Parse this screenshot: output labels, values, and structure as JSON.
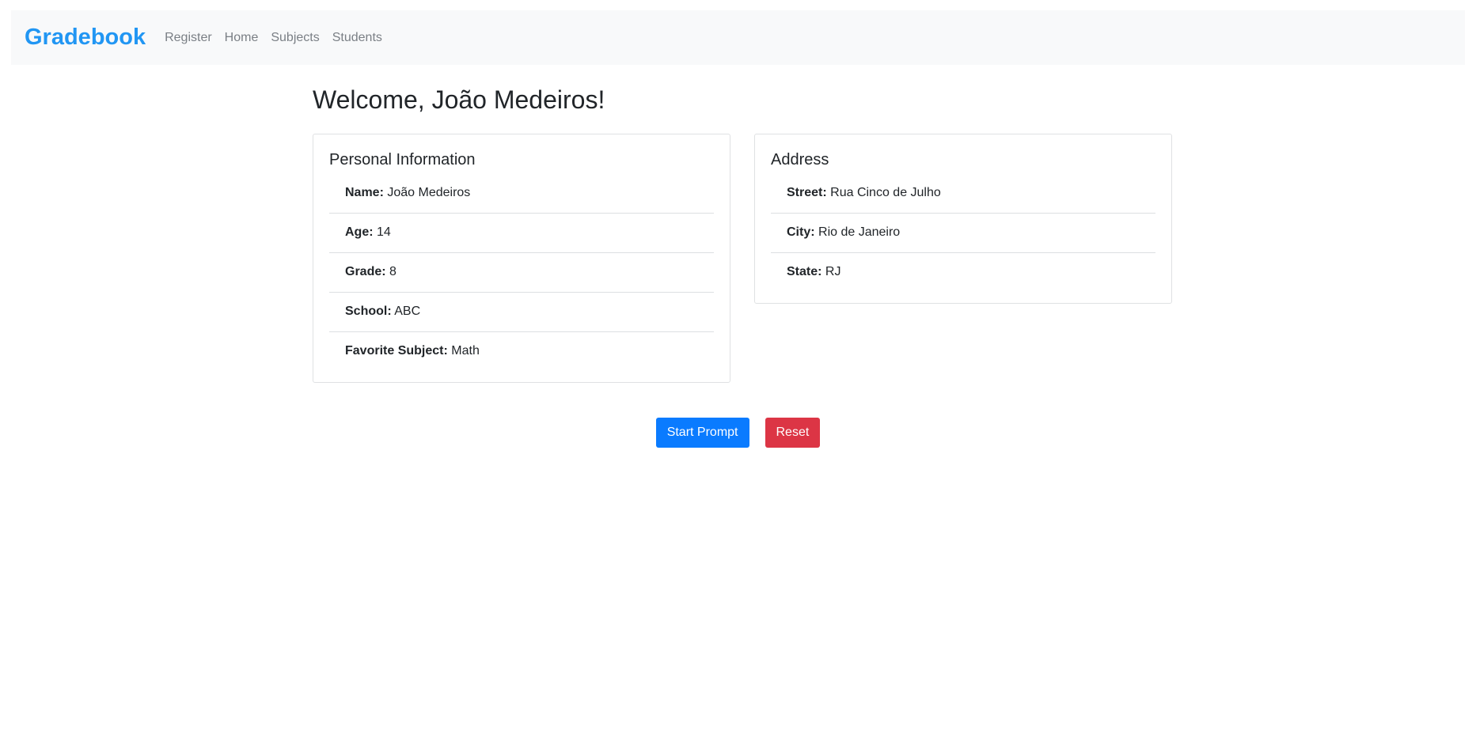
{
  "navbar": {
    "brand": "Gradebook",
    "links": [
      "Register",
      "Home",
      "Subjects",
      "Students"
    ],
    "brand_color": "#2196f3"
  },
  "main": {
    "welcome": "Welcome, João Medeiros!"
  },
  "personal": {
    "title": "Personal Information",
    "items": [
      {
        "label": "Name:",
        "value": "João Medeiros"
      },
      {
        "label": "Age:",
        "value": "14"
      },
      {
        "label": "Grade:",
        "value": "8"
      },
      {
        "label": "School:",
        "value": "ABC"
      },
      {
        "label": "Favorite Subject:",
        "value": "Math"
      }
    ]
  },
  "address": {
    "title": "Address",
    "items": [
      {
        "label": "Street:",
        "value": "Rua Cinco de Julho"
      },
      {
        "label": "City:",
        "value": "Rio de Janeiro"
      },
      {
        "label": "State:",
        "value": "RJ"
      }
    ]
  },
  "actions": {
    "start_label": "Start Prompt",
    "reset_label": "Reset",
    "start_color": "#0a7bff",
    "reset_color": "#dc3545"
  }
}
